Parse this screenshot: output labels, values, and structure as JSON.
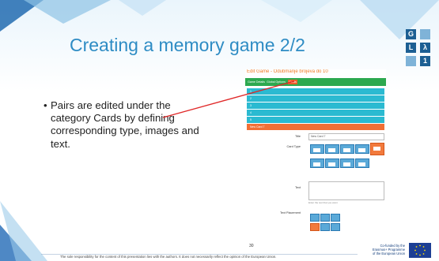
{
  "slide": {
    "title": "Creating a memory game 2/2",
    "bullet": "Pairs are edited under the category Cards by defining corresponding type, images and text.",
    "bullet_marker": "•",
    "page_number": "30",
    "disclaimer": "The sole responsibility for the content of this presentation lies with the authors. It does not necessarily reflect the opinion of the European Union.",
    "eu_text": [
      "Co-funded by the",
      "Erasmus+ Programme",
      "of the European Union"
    ],
    "logo_tiles": [
      "G",
      "L",
      "λ",
      "1"
    ]
  },
  "screenshot": {
    "title": "Edit Game - Odubmanje brojeva do 10",
    "tabs": [
      "Game Details",
      "Global Options",
      "Cards"
    ],
    "active_tab": "Cards",
    "rows": [
      "1",
      "2",
      "3",
      "4",
      "5"
    ],
    "new_row": "New Card 7",
    "fields": {
      "title_label": "Title",
      "title_value": "New Card 7",
      "card_type_label": "Card Type",
      "text_label": "Text",
      "text_hint": "Enter the text that you want",
      "text_placement_label": "Text Placement"
    }
  },
  "colors": {
    "title": "#2e8cc4",
    "tab_bar": "#2da94f",
    "active_tab": "#f05c2a",
    "rows": "#2bbad1",
    "arrow": "#e02828"
  }
}
